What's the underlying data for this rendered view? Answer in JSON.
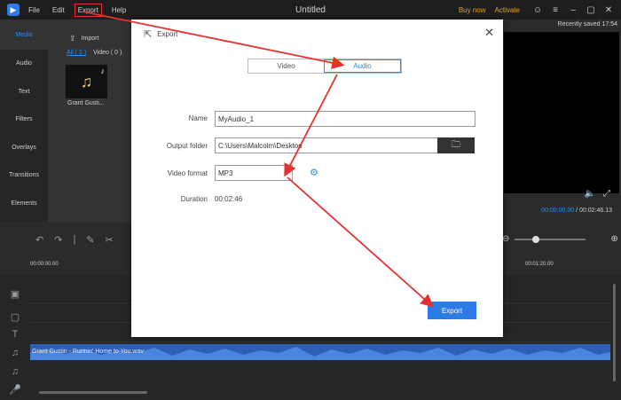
{
  "titlebar": {
    "title": "Untitled",
    "menu": [
      "File",
      "Edit",
      "Export",
      "Help"
    ],
    "buy_now": "Buy now",
    "activate": "Activate"
  },
  "sidebar": {
    "items": [
      "Media",
      "Audio",
      "Text",
      "Filters",
      "Overlays",
      "Transitions",
      "Elements"
    ]
  },
  "media": {
    "import_label": "Import",
    "filter_all": "All ( 1 )",
    "filter_video": "Video ( 0 )",
    "clip_caption": "Grant Gusti..."
  },
  "preview": {
    "saved": "Recently saved 17:54",
    "current_time": "00:00:00.00",
    "separator": "/",
    "total_time": "00:02:46.13"
  },
  "timeline": {
    "ruler": [
      "00:00:00.00",
      "00:01:20.00"
    ],
    "audio_clip": "Grant Gustin - Runnin' Home to You.wav"
  },
  "dialog": {
    "title": "Export",
    "tabs": [
      "Video",
      "Audio"
    ],
    "name_label": "Name",
    "name_value": "MyAudio_1",
    "output_label": "Output folder",
    "output_value": "C:\\Users\\Malcolm\\Desktop",
    "format_label": "Video format",
    "format_value": "MP3",
    "duration_label": "Duration",
    "duration_value": "00:02:46",
    "export_button": "Export"
  },
  "colors": {
    "accent": "#2d7be6",
    "annotation": "#e5302e"
  }
}
